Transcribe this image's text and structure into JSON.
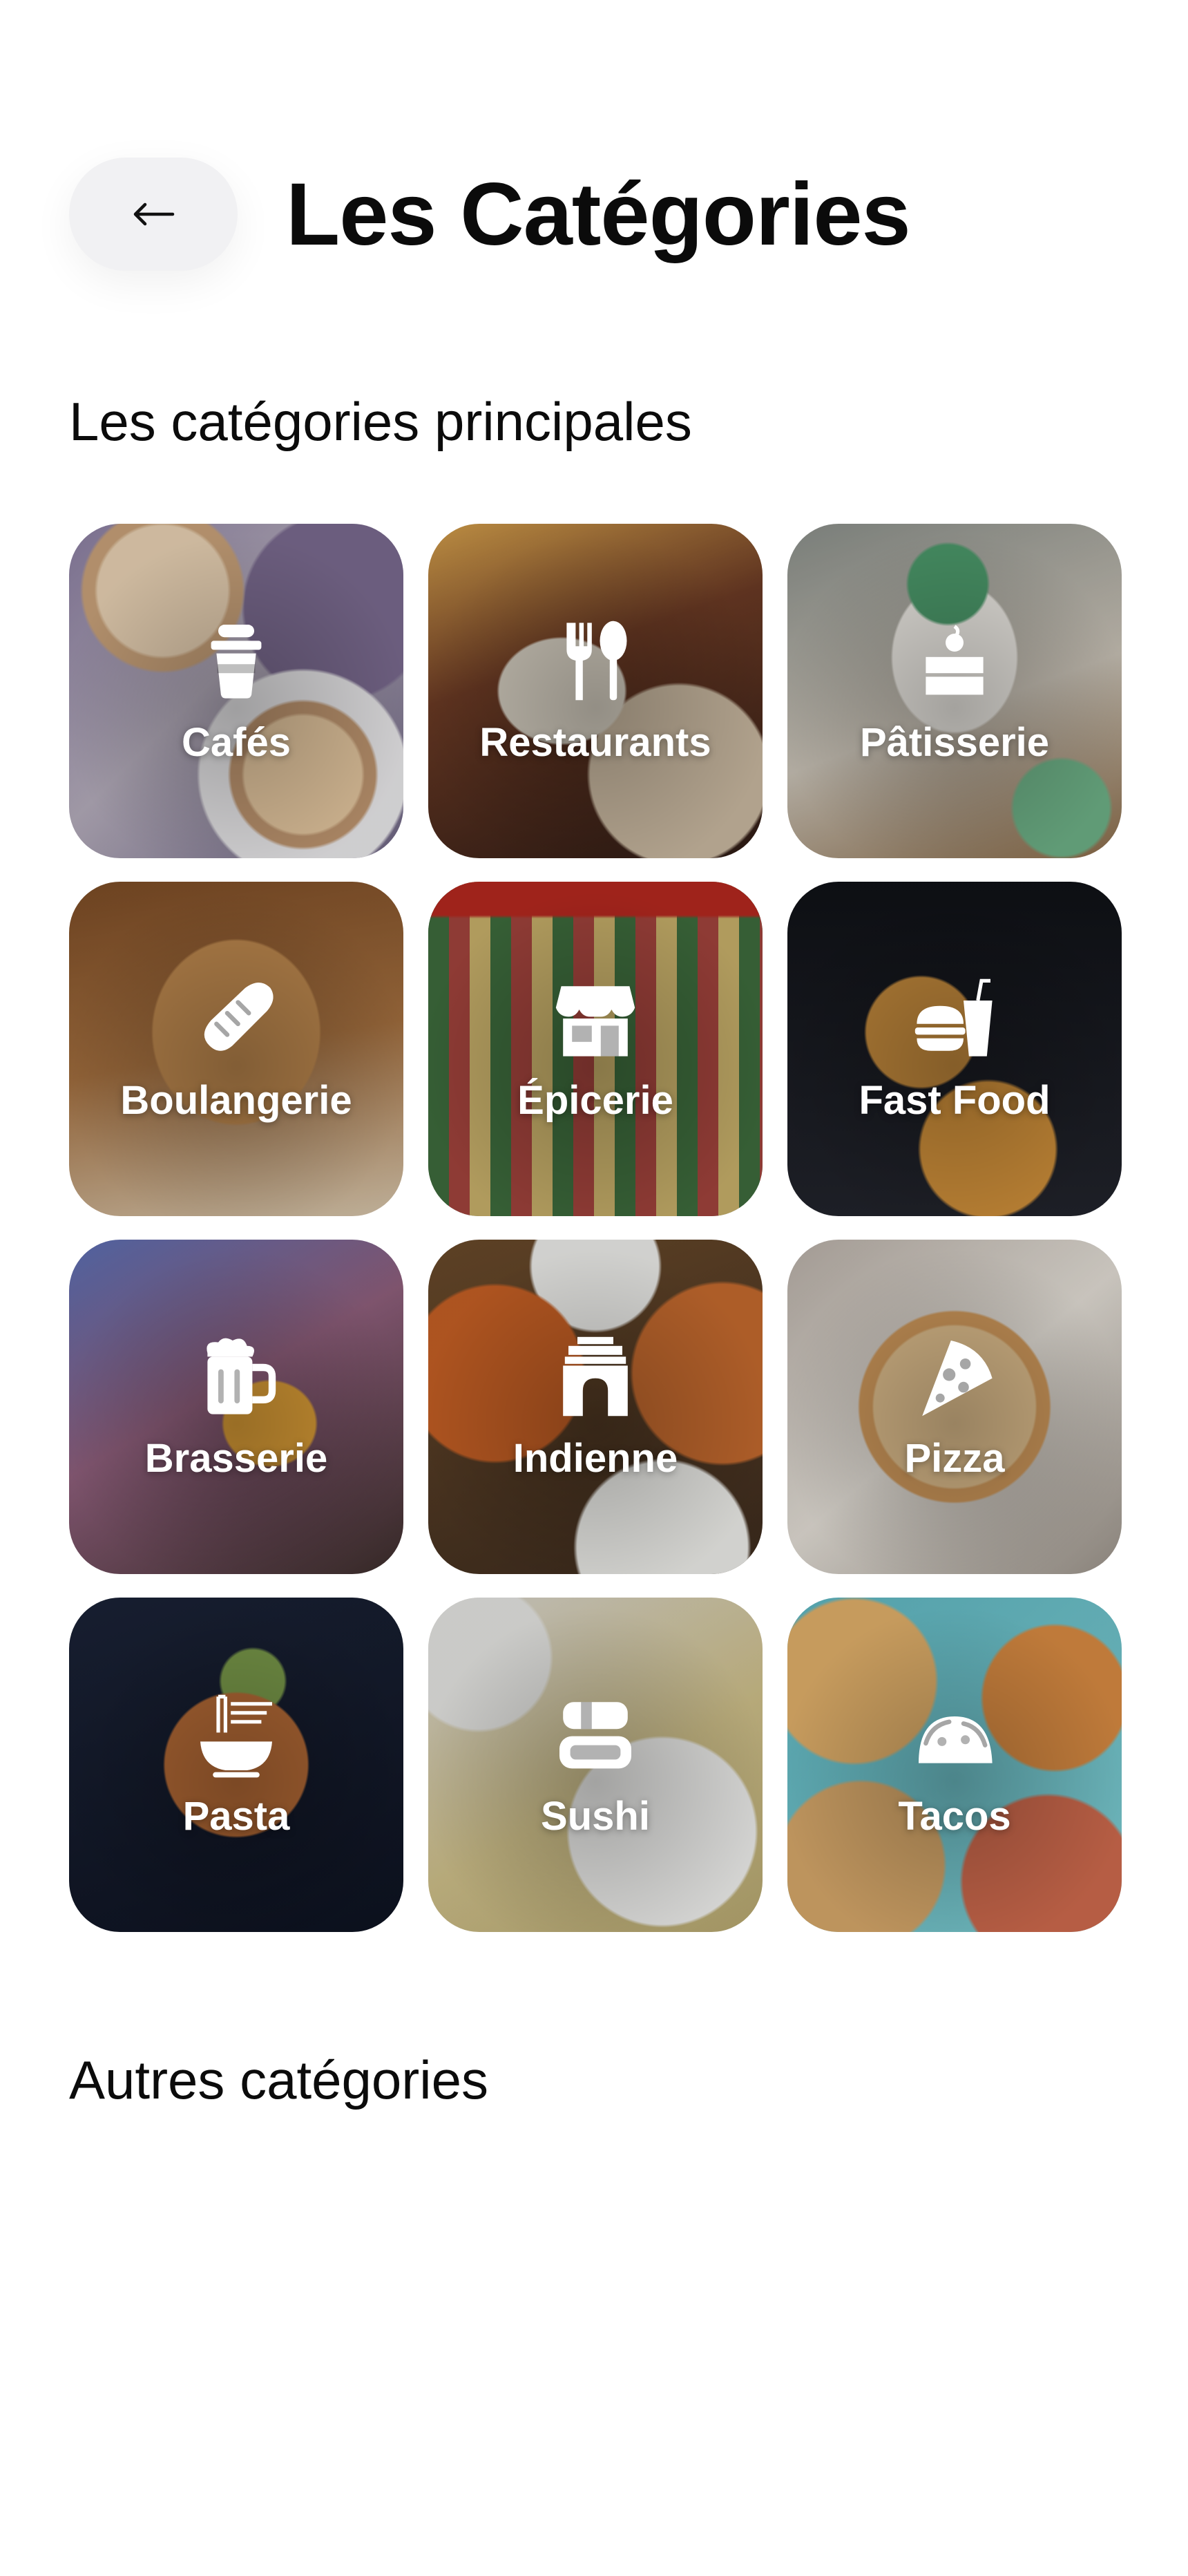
{
  "header": {
    "title": "Les Catégories",
    "back_icon": "arrow-left-icon"
  },
  "sections": {
    "main_title": "Les catégories principales",
    "other_title": "Autres catégories"
  },
  "categories": [
    {
      "label": "Cafés",
      "icon": "coffee-cup-icon"
    },
    {
      "label": "Restaurants",
      "icon": "fork-spoon-icon"
    },
    {
      "label": "Pâtisserie",
      "icon": "cake-icon"
    },
    {
      "label": "Boulangerie",
      "icon": "bread-icon"
    },
    {
      "label": "Épicerie",
      "icon": "grocery-store-icon"
    },
    {
      "label": "Fast Food",
      "icon": "burger-drink-icon"
    },
    {
      "label": "Brasserie",
      "icon": "beer-mug-icon"
    },
    {
      "label": "Indienne",
      "icon": "india-gate-icon"
    },
    {
      "label": "Pizza",
      "icon": "pizza-slice-icon"
    },
    {
      "label": "Pasta",
      "icon": "pasta-icon"
    },
    {
      "label": "Sushi",
      "icon": "sushi-icon"
    },
    {
      "label": "Tacos",
      "icon": "taco-icon"
    }
  ]
}
